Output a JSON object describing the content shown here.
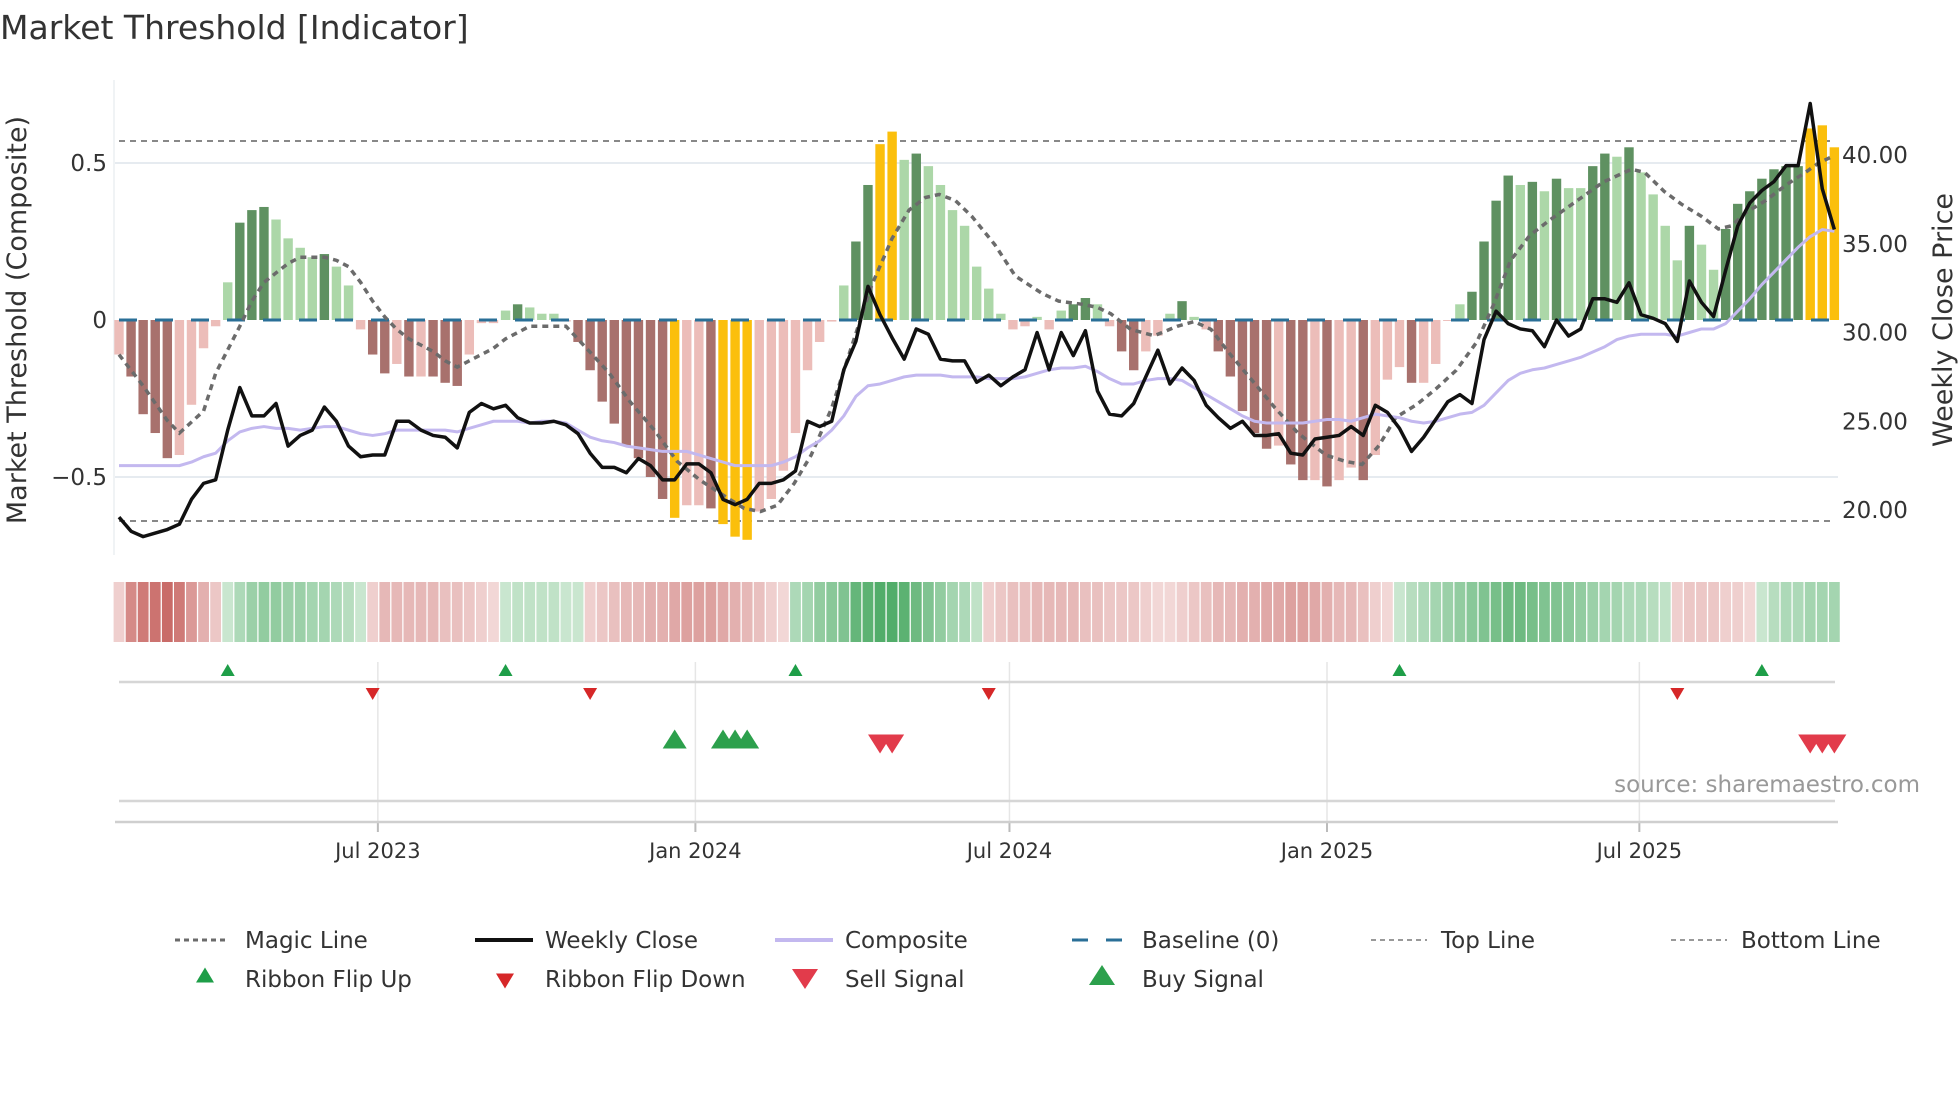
{
  "chart_data": {
    "type": "bar",
    "title": "Market Threshold [Indicator]",
    "ylabel": "Market Threshold (Composite)",
    "ylabel_right": "Weekly Close Price",
    "source": "source: sharemaestro.com",
    "start_date": "2023-02-01",
    "interval_days": 7,
    "ylim": [
      -0.75,
      0.76
    ],
    "ylim_right": [
      17.46,
      44.2
    ],
    "yticks": [
      {
        "value": 0.5,
        "label": "0.5"
      },
      {
        "value": 0,
        "label": "0"
      },
      {
        "value": -0.5,
        "label": "−0.5"
      }
    ],
    "yticks_right": [
      {
        "value": 40,
        "label": "40.00"
      },
      {
        "value": 35,
        "label": "35.00"
      },
      {
        "value": 30,
        "label": "30.00"
      },
      {
        "value": 25,
        "label": "25.00"
      },
      {
        "value": 20,
        "label": "20.00"
      }
    ],
    "xticks": [
      {
        "date": "2023-07-01",
        "label": "Jul 2023"
      },
      {
        "date": "2024-01-01",
        "label": "Jan 2024"
      },
      {
        "date": "2024-07-01",
        "label": "Jul 2024"
      },
      {
        "date": "2025-01-01",
        "label": "Jan 2025"
      },
      {
        "date": "2025-07-01",
        "label": "Jul 2025"
      }
    ],
    "top_line": 0.57,
    "bottom_line": -0.64,
    "baseline": 0,
    "composite_bars": [
      -0.11,
      -0.18,
      -0.3,
      -0.36,
      -0.44,
      -0.43,
      -0.27,
      -0.09,
      -0.02,
      0.12,
      0.31,
      0.35,
      0.36,
      0.32,
      0.26,
      0.23,
      0.2,
      0.21,
      0.17,
      0.11,
      -0.03,
      -0.11,
      -0.17,
      -0.14,
      -0.18,
      -0.18,
      -0.18,
      -0.2,
      -0.21,
      -0.11,
      -0.01,
      -0.01,
      0.03,
      0.05,
      0.04,
      0.02,
      0.02,
      -0.005,
      -0.07,
      -0.16,
      -0.26,
      -0.33,
      -0.4,
      -0.44,
      -0.5,
      -0.57,
      -0.63,
      -0.59,
      -0.59,
      -0.6,
      -0.65,
      -0.69,
      -0.7,
      -0.61,
      -0.57,
      -0.48,
      -0.36,
      -0.16,
      -0.07,
      -0.005,
      0.11,
      0.25,
      0.43,
      0.56,
      0.6,
      0.51,
      0.53,
      0.49,
      0.43,
      0.35,
      0.3,
      0.17,
      0.1,
      0.02,
      -0.03,
      -0.02,
      0.01,
      -0.03,
      0.03,
      0.05,
      0.07,
      0.05,
      -0.02,
      -0.1,
      -0.16,
      -0.1,
      -0.05,
      0.02,
      0.06,
      0.01,
      -0.03,
      -0.1,
      -0.18,
      -0.29,
      -0.36,
      -0.41,
      -0.4,
      -0.46,
      -0.51,
      -0.51,
      -0.53,
      -0.51,
      -0.47,
      -0.51,
      -0.43,
      -0.19,
      -0.15,
      -0.2,
      -0.2,
      -0.14,
      -0.003,
      0.05,
      0.09,
      0.25,
      0.38,
      0.46,
      0.43,
      0.44,
      0.41,
      0.45,
      0.42,
      0.42,
      0.49,
      0.53,
      0.52,
      0.55,
      0.47,
      0.4,
      0.3,
      0.19,
      0.3,
      0.24,
      0.16,
      0.29,
      0.37,
      0.41,
      0.45,
      0.48,
      0.49,
      0.49,
      0.61,
      0.62,
      0.55
    ],
    "bar_states": [
      "lr",
      "dr",
      "dr",
      "dr",
      "dr",
      "lr",
      "lr",
      "lr",
      "lr",
      "lg",
      "dg",
      "dg",
      "dg",
      "lg",
      "lg",
      "lg",
      "lg",
      "dg",
      "lg",
      "lg",
      "lr",
      "dr",
      "dr",
      "lr",
      "dr",
      "lr",
      "dr",
      "dr",
      "dr",
      "lr",
      "lr",
      "lr",
      "lg",
      "dg",
      "lg",
      "lg",
      "lg",
      "lr",
      "dr",
      "dr",
      "dr",
      "dr",
      "dr",
      "dr",
      "dr",
      "dr",
      "y",
      "lr",
      "lr",
      "dr",
      "y",
      "y",
      "y",
      "lr",
      "lr",
      "lr",
      "lr",
      "lr",
      "lr",
      "lr",
      "lg",
      "dg",
      "dg",
      "y",
      "y",
      "lg",
      "dg",
      "lg",
      "lg",
      "lg",
      "lg",
      "lg",
      "lg",
      "lg",
      "lr",
      "lr",
      "lg",
      "lr",
      "lg",
      "dg",
      "dg",
      "lg",
      "lr",
      "dr",
      "dr",
      "lr",
      "lr",
      "lg",
      "dg",
      "lg",
      "lr",
      "dr",
      "dr",
      "dr",
      "dr",
      "dr",
      "lr",
      "dr",
      "dr",
      "lr",
      "dr",
      "lr",
      "lr",
      "dr",
      "lr",
      "lr",
      "lr",
      "dr",
      "lr",
      "lr",
      "lr",
      "lg",
      "dg",
      "dg",
      "dg",
      "dg",
      "lg",
      "dg",
      "lg",
      "dg",
      "lg",
      "lg",
      "dg",
      "dg",
      "lg",
      "dg",
      "lg",
      "lg",
      "lg",
      "lg",
      "dg",
      "lg",
      "lg",
      "dg",
      "dg",
      "dg",
      "dg",
      "dg",
      "dg",
      "dg",
      "y",
      "y",
      "y"
    ],
    "bar_colors": {
      "dr": "#a8716d",
      "lr": "#ecbdb9",
      "dg": "#5f9161",
      "lg": "#acd7a8",
      "y": "#fbbf0c"
    },
    "weekly_close": [
      19.6,
      18.8,
      18.5,
      18.7,
      18.9,
      19.2,
      20.6,
      21.5,
      21.7,
      24.5,
      26.9,
      25.3,
      25.3,
      26.0,
      23.6,
      24.2,
      24.5,
      25.8,
      25.0,
      23.6,
      23.0,
      23.1,
      23.1,
      25.0,
      25.0,
      24.5,
      24.2,
      24.1,
      23.5,
      25.5,
      26.0,
      25.7,
      25.9,
      25.2,
      24.9,
      24.9,
      25.0,
      24.8,
      24.3,
      23.2,
      22.4,
      22.4,
      22.1,
      22.9,
      22.5,
      21.7,
      21.7,
      22.6,
      22.6,
      22.1,
      20.6,
      20.3,
      20.6,
      21.5,
      21.5,
      21.7,
      22.2,
      25.0,
      24.7,
      25.0,
      27.9,
      29.5,
      32.6,
      31.0,
      29.7,
      28.5,
      30.2,
      29.9,
      28.5,
      28.4,
      28.4,
      27.2,
      27.6,
      27.0,
      27.5,
      27.9,
      30.0,
      27.9,
      30.0,
      28.7,
      30.1,
      26.7,
      25.4,
      25.3,
      26.0,
      27.5,
      29.0,
      27.1,
      28.0,
      27.3,
      25.9,
      25.2,
      24.6,
      25.0,
      24.2,
      24.2,
      24.3,
      23.2,
      23.1,
      24.0,
      24.1,
      24.2,
      24.7,
      24.2,
      25.9,
      25.5,
      24.6,
      23.3,
      24.1,
      25.1,
      26.1,
      26.5,
      26.0,
      29.6,
      31.2,
      30.5,
      30.2,
      30.1,
      29.2,
      30.7,
      29.8,
      30.2,
      31.9,
      31.9,
      31.7,
      32.8,
      31.0,
      30.8,
      30.5,
      29.5,
      32.9,
      31.7,
      30.9,
      33.5,
      36.0,
      37.3,
      38.0,
      38.5,
      39.4,
      39.4,
      42.9,
      38.1,
      35.8
    ],
    "composite_line": [
      22.5,
      22.5,
      22.5,
      22.5,
      22.5,
      22.5,
      22.7,
      23.0,
      23.2,
      23.9,
      24.4,
      24.6,
      24.7,
      24.6,
      24.6,
      24.5,
      24.6,
      24.7,
      24.7,
      24.5,
      24.3,
      24.2,
      24.3,
      24.5,
      24.5,
      24.5,
      24.5,
      24.5,
      24.4,
      24.6,
      24.8,
      25.0,
      25.0,
      25.0,
      24.9,
      25.0,
      25.0,
      24.9,
      24.5,
      24.1,
      23.9,
      23.8,
      23.6,
      23.5,
      23.4,
      23.3,
      23.3,
      23.3,
      23.1,
      22.9,
      22.7,
      22.5,
      22.5,
      22.5,
      22.5,
      22.7,
      23.0,
      23.5,
      23.9,
      24.5,
      25.3,
      26.4,
      27.0,
      27.1,
      27.3,
      27.5,
      27.6,
      27.6,
      27.6,
      27.5,
      27.5,
      27.5,
      27.4,
      27.4,
      27.4,
      27.5,
      27.7,
      27.9,
      28.0,
      28.0,
      28.1,
      27.8,
      27.4,
      27.1,
      27.1,
      27.3,
      27.4,
      27.4,
      27.3,
      26.9,
      26.5,
      26.1,
      25.7,
      25.3,
      25.0,
      24.9,
      24.9,
      24.9,
      24.9,
      25.0,
      25.1,
      25.1,
      25.0,
      25.2,
      25.4,
      25.3,
      25.2,
      25.0,
      24.9,
      25.0,
      25.2,
      25.4,
      25.5,
      25.9,
      26.6,
      27.3,
      27.7,
      27.9,
      28.0,
      28.2,
      28.4,
      28.6,
      28.9,
      29.2,
      29.6,
      29.8,
      29.9,
      29.9,
      29.9,
      29.8,
      30.0,
      30.2,
      30.2,
      30.5,
      31.2,
      31.9,
      32.7,
      33.4,
      34.1,
      34.8,
      35.4,
      35.8,
      35.7
    ],
    "magic_line": [
      [
        0,
        -0.11
      ],
      [
        2,
        -0.21
      ],
      [
        4,
        -0.32
      ],
      [
        5,
        -0.36
      ],
      [
        7,
        -0.29
      ],
      [
        8,
        -0.17
      ],
      [
        10,
        -0.02
      ],
      [
        11,
        0.06
      ],
      [
        12,
        0.12
      ],
      [
        13,
        0.15
      ],
      [
        14,
        0.18
      ],
      [
        15,
        0.2
      ],
      [
        17,
        0.2
      ],
      [
        18,
        0.19
      ],
      [
        19,
        0.17
      ],
      [
        20,
        0.12
      ],
      [
        21,
        0.06
      ],
      [
        22,
        0.01
      ],
      [
        23,
        -0.03
      ],
      [
        24,
        -0.06
      ],
      [
        25,
        -0.08
      ],
      [
        26,
        -0.1
      ],
      [
        27,
        -0.13
      ],
      [
        28,
        -0.15
      ],
      [
        29,
        -0.13
      ],
      [
        30,
        -0.11
      ],
      [
        31,
        -0.09
      ],
      [
        32,
        -0.06
      ],
      [
        33,
        -0.04
      ],
      [
        34,
        -0.02
      ],
      [
        37,
        -0.02
      ],
      [
        38.7,
        -0.09
      ],
      [
        40.6,
        -0.17
      ],
      [
        42.3,
        -0.26
      ],
      [
        44.3,
        -0.35
      ],
      [
        46.2,
        -0.45
      ],
      [
        48.1,
        -0.51
      ],
      [
        50.1,
        -0.56
      ],
      [
        51.75,
        -0.6
      ],
      [
        53.1,
        -0.61
      ],
      [
        54.5,
        -0.59
      ],
      [
        55.9,
        -0.52
      ],
      [
        57.3,
        -0.43
      ],
      [
        59,
        -0.28
      ],
      [
        60.6,
        -0.09
      ],
      [
        62.3,
        0.11
      ],
      [
        64,
        0.26
      ],
      [
        65.4,
        0.35
      ],
      [
        66.75,
        0.39
      ],
      [
        67.9,
        0.4
      ],
      [
        69.25,
        0.38
      ],
      [
        70.6,
        0.33
      ],
      [
        72.5,
        0.24
      ],
      [
        74.2,
        0.14
      ],
      [
        76.4,
        0.085
      ],
      [
        77.8,
        0.06
      ],
      [
        79.75,
        0.05
      ],
      [
        81,
        0.04
      ],
      [
        82.1,
        0.02
      ],
      [
        83.75,
        -0.03
      ],
      [
        85.7,
        -0.05
      ],
      [
        87.6,
        -0.02
      ],
      [
        89,
        -0.005
      ],
      [
        90.4,
        -0.03
      ],
      [
        92,
        -0.11
      ],
      [
        93.75,
        -0.19
      ],
      [
        95.7,
        -0.28
      ],
      [
        97.6,
        -0.36
      ],
      [
        99.9,
        -0.43
      ],
      [
        101.5,
        -0.45
      ],
      [
        102.9,
        -0.46
      ],
      [
        104.3,
        -0.4
      ],
      [
        105.7,
        -0.31
      ],
      [
        107.4,
        -0.27
      ],
      [
        109,
        -0.22
      ],
      [
        110.7,
        -0.16
      ],
      [
        112.4,
        -0.07
      ],
      [
        113.8,
        0.05
      ],
      [
        115.2,
        0.19
      ],
      [
        116.8,
        0.27
      ],
      [
        118.5,
        0.32
      ],
      [
        120.7,
        0.38
      ],
      [
        122.9,
        0.44
      ],
      [
        125.2,
        0.48
      ],
      [
        126.3,
        0.47
      ],
      [
        127.9,
        0.41
      ],
      [
        129.3,
        0.37
      ],
      [
        131,
        0.33
      ],
      [
        132.4,
        0.29
      ],
      [
        133.5,
        0.3
      ],
      [
        134.6,
        0.34
      ],
      [
        136.3,
        0.38
      ],
      [
        138,
        0.43
      ],
      [
        139.6,
        0.47
      ],
      [
        140.7,
        0.5
      ],
      [
        141.8,
        0.52
      ]
    ],
    "ribbon": [
      -0.15,
      -0.6,
      -0.7,
      -0.75,
      -0.8,
      -0.7,
      -0.5,
      -0.35,
      -0.2,
      0.15,
      0.3,
      0.4,
      0.45,
      0.45,
      0.4,
      0.4,
      0.35,
      0.35,
      0.3,
      0.25,
      0.15,
      -0.15,
      -0.3,
      -0.3,
      -0.3,
      -0.3,
      -0.3,
      -0.25,
      -0.25,
      -0.2,
      -0.15,
      -0.1,
      0.15,
      0.2,
      0.2,
      0.2,
      0.2,
      0.15,
      0.15,
      -0.15,
      -0.2,
      -0.25,
      -0.3,
      -0.3,
      -0.35,
      -0.35,
      -0.4,
      -0.45,
      -0.45,
      -0.45,
      -0.4,
      -0.35,
      -0.3,
      -0.25,
      -0.15,
      -0.1,
      0.3,
      0.35,
      0.45,
      0.5,
      0.55,
      0.7,
      0.75,
      0.8,
      0.8,
      0.75,
      0.65,
      0.55,
      0.45,
      0.35,
      0.3,
      0.2,
      -0.15,
      -0.2,
      -0.25,
      -0.25,
      -0.3,
      -0.3,
      -0.3,
      -0.3,
      -0.25,
      -0.25,
      -0.2,
      -0.2,
      -0.2,
      -0.15,
      -0.1,
      -0.1,
      -0.15,
      -0.2,
      -0.25,
      -0.3,
      -0.3,
      -0.35,
      -0.35,
      -0.4,
      -0.4,
      -0.45,
      -0.45,
      -0.4,
      -0.35,
      -0.3,
      -0.3,
      -0.25,
      -0.15,
      -0.1,
      0.15,
      0.25,
      0.3,
      0.35,
      0.4,
      0.45,
      0.5,
      0.55,
      0.6,
      0.65,
      0.65,
      0.6,
      0.55,
      0.55,
      0.5,
      0.45,
      0.4,
      0.35,
      0.35,
      0.3,
      0.3,
      0.25,
      0.2,
      -0.15,
      -0.2,
      -0.2,
      -0.2,
      -0.15,
      -0.15,
      -0.1,
      0.15,
      0.25,
      0.3,
      0.3,
      0.35,
      0.35,
      0.35
    ],
    "ribbon_flip_up": [
      9,
      32,
      56,
      106,
      136
    ],
    "ribbon_flip_down": [
      21,
      39,
      72,
      129
    ],
    "buy_signals": [
      46,
      50,
      51,
      52
    ],
    "sell_signals": [
      63,
      64,
      140,
      141,
      142
    ],
    "colors": {
      "close": "#111111",
      "composite": "#c3b8ef",
      "magic": "#6b6b6b",
      "baseline": "#2a6f97",
      "flip_up": "#1e9e48",
      "flip_down": "#d62728",
      "buy": "#2ca04c",
      "sell": "#e23b4b"
    },
    "legend": [
      {
        "label": "Magic Line",
        "symbol": "dotted"
      },
      {
        "label": "Weekly Close",
        "symbol": "line-black"
      },
      {
        "label": "Composite",
        "symbol": "line-lavender"
      },
      {
        "label": "Baseline (0)",
        "symbol": "dashed-blue"
      },
      {
        "label": "Top Line",
        "symbol": "dotted-thin"
      },
      {
        "label": "Bottom Line",
        "symbol": "dotted-thin"
      },
      {
        "label": "Ribbon Flip Up",
        "symbol": "tri-up-small"
      },
      {
        "label": "Ribbon Flip Down",
        "symbol": "tri-down-small"
      },
      {
        "label": "Sell Signal",
        "symbol": "tri-down-large"
      },
      {
        "label": "Buy Signal",
        "symbol": "tri-up-large"
      }
    ]
  }
}
